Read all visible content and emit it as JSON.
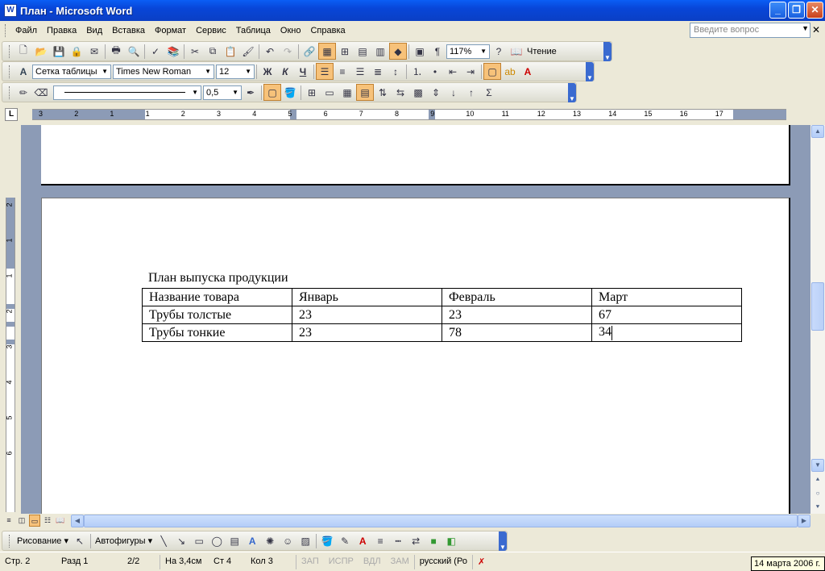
{
  "window": {
    "title": "План - Microsoft Word",
    "icon_letter": "W"
  },
  "menu": {
    "items": [
      "Файл",
      "Правка",
      "Вид",
      "Вставка",
      "Формат",
      "Сервис",
      "Таблица",
      "Окно",
      "Справка"
    ],
    "help_placeholder": "Введите вопрос"
  },
  "standard_toolbar": {
    "zoom": "117%",
    "reading_label": "Чтение"
  },
  "formatting_toolbar": {
    "style": "Сетка таблицы",
    "font": "Times New Roman",
    "size": "12"
  },
  "tables_toolbar": {
    "line_weight": "0,5"
  },
  "ruler": {
    "h_labels": [
      "3",
      "2",
      "1",
      "1",
      "2",
      "3",
      "4",
      "5",
      "6",
      "7",
      "8",
      "9",
      "10",
      "11",
      "12",
      "13",
      "14",
      "15",
      "16",
      "17"
    ],
    "v_labels": [
      "2",
      "1",
      "1",
      "2",
      "3",
      "4",
      "5",
      "6"
    ]
  },
  "document": {
    "heading": "План выпуска продукции",
    "table": [
      [
        "Название товара",
        "Январь",
        "Февраль",
        "Март"
      ],
      [
        "Трубы толстые",
        "23",
        "23",
        "67"
      ],
      [
        "Трубы тонкие",
        "23",
        "78",
        "34"
      ]
    ]
  },
  "drawing_toolbar": {
    "draw_label": "Рисование",
    "autoshapes_label": "Автофигуры"
  },
  "status": {
    "page": "Стр. 2",
    "section": "Разд 1",
    "pages": "2/2",
    "at": "На 3,4см",
    "line": "Ст 4",
    "col": "Кол 3",
    "rec": "ЗАП",
    "trk": "ИСПР",
    "ext": "ВДЛ",
    "ovr": "ЗАМ",
    "lang": "русский (Ро"
  },
  "tooltip": "14 марта 2006 г."
}
